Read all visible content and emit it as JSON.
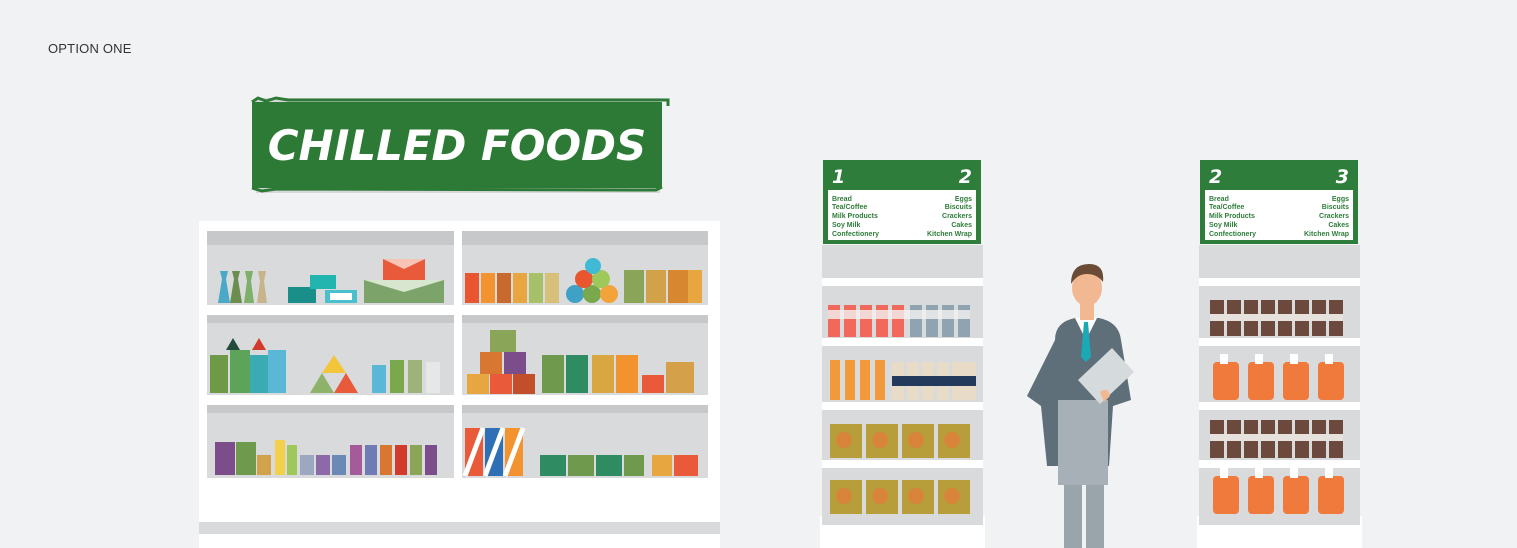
{
  "page_label": "OPTION ONE",
  "banner": {
    "text": "CHILLED FOODS"
  },
  "aisle_sign_a": {
    "left_number": "1",
    "right_number": "2",
    "left_items": [
      "Bread",
      "Tea/Coffee",
      "Milk Products",
      "Soy Milk",
      "Confectionery"
    ],
    "right_items": [
      "Eggs",
      "Biscuits",
      "Crackers",
      "Cakes",
      "Kitchen Wrap"
    ]
  },
  "aisle_sign_b": {
    "left_number": "2",
    "right_number": "3",
    "left_items": [
      "Bread",
      "Tea/Coffee",
      "Milk Products",
      "Soy Milk",
      "Confectionery"
    ],
    "right_items": [
      "Eggs",
      "Biscuits",
      "Crackers",
      "Cakes",
      "Kitchen Wrap"
    ]
  },
  "colors": {
    "background": "#f1f2f4",
    "sign_green": "#2e7d3a",
    "shelf_grey": "#d9dadc",
    "suit": "#5f6f7a"
  }
}
